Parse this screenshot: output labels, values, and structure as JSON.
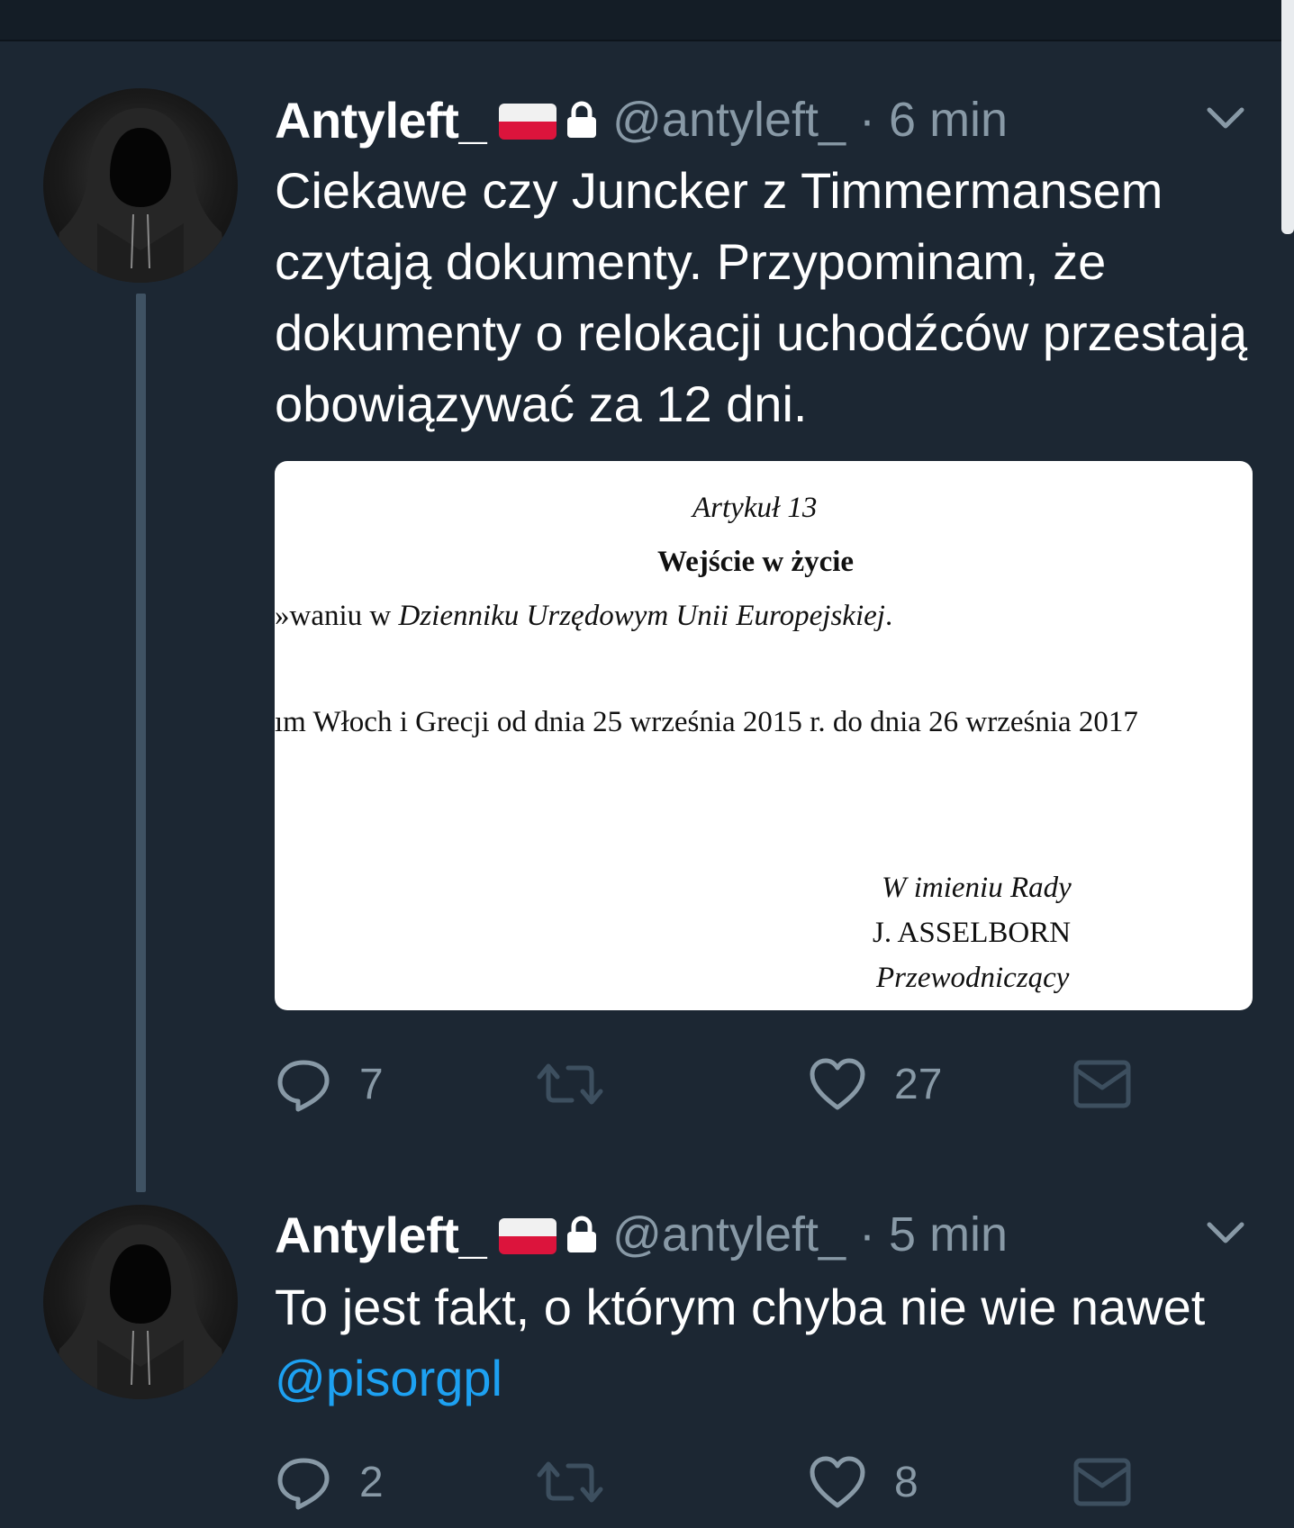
{
  "tweets": [
    {
      "author_name": "Antyleft_",
      "handle_time": "@antyleft_ · 6 min",
      "text": "Ciekawe czy Juncker z Timmermansem czytają dokumenty. Przypominam, że dokumenty o relokacji uchodźców przestają obowiązywać za 12 dni.",
      "media": {
        "article_title": "Artykuł 13",
        "article_heading": "Wejście w życie",
        "line1_prefix": "»waniu w ",
        "line1_italic": "Dzienniku Urzędowym Unii Europejskiej",
        "line1_suffix": ".",
        "line2": "ım Włoch i Grecji od dnia 25 września 2015 r. do dnia 26 września 2017",
        "sign_on_behalf": "W imieniu Rady",
        "sign_name": "J. ASSELBORN",
        "sign_role": "Przewodniczący"
      },
      "reply_count": "7",
      "like_count": "27"
    },
    {
      "author_name": "Antyleft_",
      "handle_time": "@antyleft_ · 5 min",
      "text_before_mention": "To jest fakt, o którym chyba nie wie nawet ",
      "mention": "@pisorgpl",
      "reply_count": "2",
      "like_count": "8"
    }
  ],
  "icons": {
    "reply": "reply-icon",
    "retweet": "retweet-icon",
    "like": "heart-icon",
    "message": "envelope-icon",
    "menu": "chevron-down-icon",
    "lock": "lock-icon",
    "flag": "poland-flag-icon"
  },
  "colors": {
    "background": "#1c2733",
    "secondary_text": "#8899a6",
    "mention": "#1da1f2",
    "thread_line": "#3f5263"
  }
}
